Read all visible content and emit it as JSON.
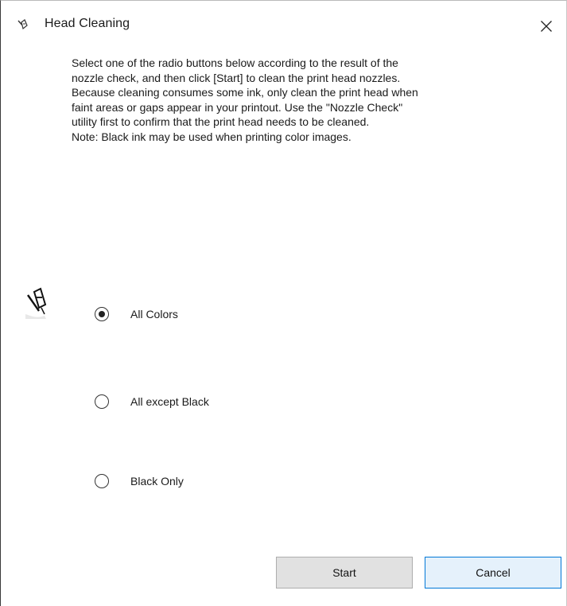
{
  "window": {
    "title": "Head Cleaning",
    "title_icon": "printer-head-icon",
    "close_icon": "close-icon",
    "close_glyph": "✕"
  },
  "description": "Select one of the radio buttons below according to the result of the\nnozzle check, and then click [Start] to clean the print head nozzles.\nBecause cleaning consumes some ink, only clean the print head when\nfaint areas or gaps appear in your printout. Use the \"Nozzle Check\"\nutility first to confirm that the print head needs to be cleaned.\nNote: Black ink may be used when printing color images.",
  "options": [
    {
      "label": "All Colors",
      "selected": true
    },
    {
      "label": "All except Black",
      "selected": false
    },
    {
      "label": "Black Only",
      "selected": false
    }
  ],
  "buttons": {
    "start_label": "Start",
    "cancel_label": "Cancel"
  },
  "colors": {
    "default_button_border": "#0078d7",
    "default_button_fill": "#e5f1fb",
    "button_fill": "#e1e1e1"
  }
}
